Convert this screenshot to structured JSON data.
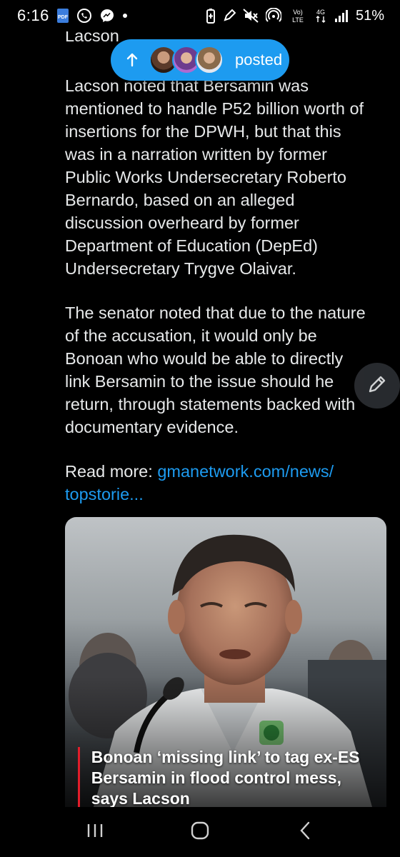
{
  "status_bar": {
    "time": "6:16",
    "left_icons": [
      "pdf-icon",
      "viber-icon",
      "messenger-icon",
      "notification-dot-icon"
    ],
    "right_icons": [
      "battery-saver-icon",
      "edit-icon",
      "mute-icon",
      "hotspot-icon",
      "volte-icon",
      "4g-icon",
      "signal-icon"
    ],
    "volte_label": "Vo) LTE",
    "network_label": "4G",
    "battery": "51%"
  },
  "new_posts_pill": {
    "label": "posted",
    "avatar_count": 3
  },
  "article": {
    "clipped_top_word": "Lacson",
    "paragraphs": [
      "Lacson noted that Bersamin was\nmentioned to handle P52 billion worth of\ninsertions for the DPWH, but that this\nwas in a narration written by former\nPublic Works Undersecretary Roberto\nBernardo, based on an alleged\ndiscussion overheard by former\nDepartment of Education (DepEd)\nUndersecretary Trygve Olaivar.",
      "The senator noted that due to the nature\nof the accusation, it would only be\nBonoan who would be able to directly\nlink Bersamin to the issue should he\nreturn, through statements backed with\ndocumentary evidence."
    ],
    "read_more_label": "Read more: ",
    "read_more_link_line1": "gmanetwork.com/news/",
    "read_more_link_line2": "topstorie..."
  },
  "media_card": {
    "headline": "Bonoan ‘missing link’ to tag ex-ES Bersamin in flood control mess, says Lacson",
    "accent_color": "#e11d2a"
  },
  "colors": {
    "background": "#000000",
    "text": "#e7e9ea",
    "link": "#1d9bf0",
    "pill": "#1d9bf0"
  },
  "nav_bar": {
    "buttons": [
      "recents-icon",
      "home-icon",
      "back-icon"
    ]
  }
}
